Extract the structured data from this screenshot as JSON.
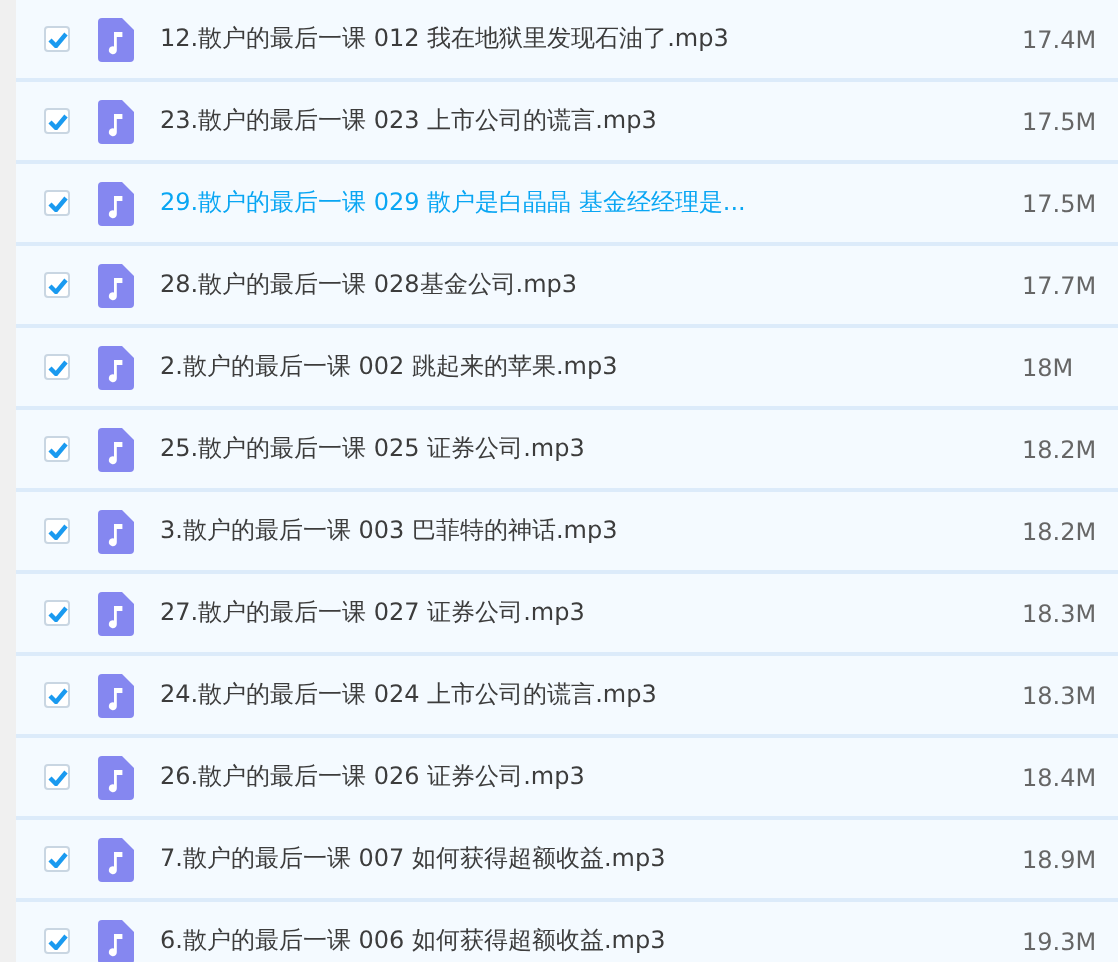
{
  "files": [
    {
      "name": "12.散户的最后一课 012 我在地狱里发现石油了.mp3",
      "size": "17.4M",
      "checked": true,
      "highlighted": false
    },
    {
      "name": "23.散户的最后一课 023 上市公司的谎言.mp3",
      "size": "17.5M",
      "checked": true,
      "highlighted": false
    },
    {
      "name": "29.散户的最后一课 029 散户是白晶晶 基金经经理是...",
      "size": "17.5M",
      "checked": true,
      "highlighted": true
    },
    {
      "name": "28.散户的最后一课 028基金公司.mp3",
      "size": "17.7M",
      "checked": true,
      "highlighted": false
    },
    {
      "name": "2.散户的最后一课 002 跳起来的苹果.mp3",
      "size": "18M",
      "checked": true,
      "highlighted": false
    },
    {
      "name": "25.散户的最后一课 025 证券公司.mp3",
      "size": "18.2M",
      "checked": true,
      "highlighted": false
    },
    {
      "name": "3.散户的最后一课 003 巴菲特的神话.mp3",
      "size": "18.2M",
      "checked": true,
      "highlighted": false
    },
    {
      "name": "27.散户的最后一课 027 证券公司.mp3",
      "size": "18.3M",
      "checked": true,
      "highlighted": false
    },
    {
      "name": "24.散户的最后一课 024 上市公司的谎言.mp3",
      "size": "18.3M",
      "checked": true,
      "highlighted": false
    },
    {
      "name": "26.散户的最后一课 026 证券公司.mp3",
      "size": "18.4M",
      "checked": true,
      "highlighted": false
    },
    {
      "name": "7.散户的最后一课 007 如何获得超额收益.mp3",
      "size": "18.9M",
      "checked": true,
      "highlighted": false
    },
    {
      "name": "6.散户的最后一课 006 如何获得超额收益.mp3",
      "size": "19.3M",
      "checked": true,
      "highlighted": false
    }
  ]
}
